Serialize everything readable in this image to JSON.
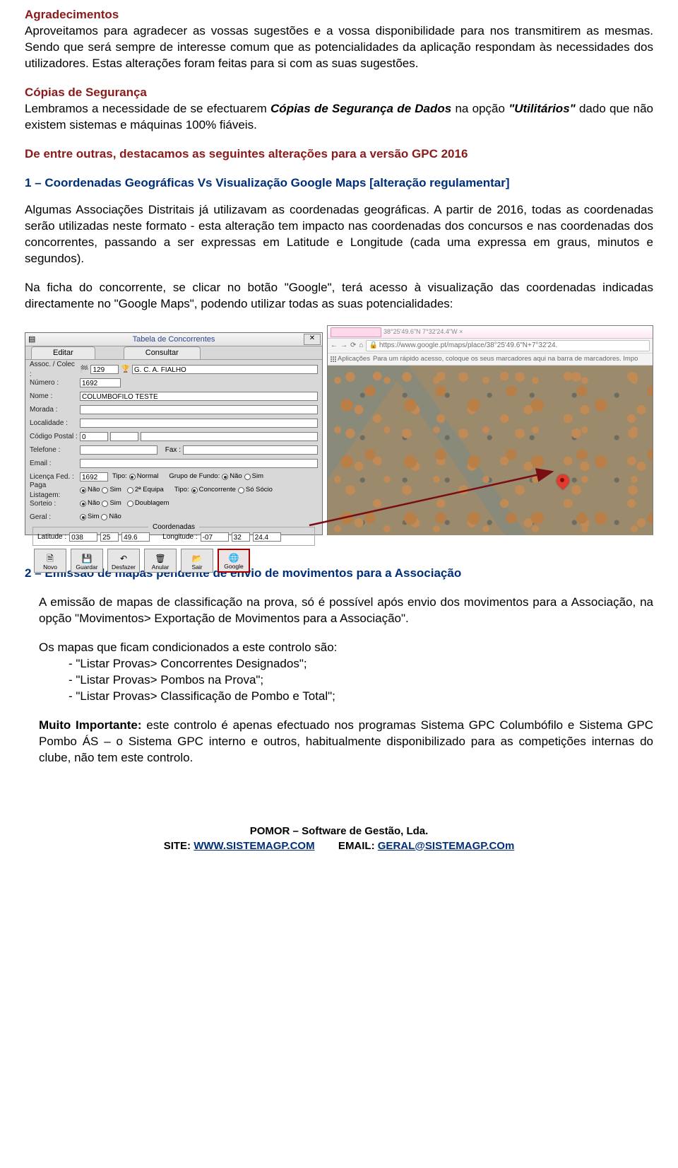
{
  "sec1": {
    "title": "Agradecimentos",
    "p1": "Aproveitamos para agradecer as vossas sugestões e a vossa disponibilidade para nos transmitirem as mesmas. Sendo que será sempre de interesse comum que as potencialidades da aplicação respondam às necessidades dos utilizadores. Estas alterações foram feitas para si com as suas sugestões."
  },
  "sec2": {
    "title": "Cópias de Segurança",
    "p1a": "Lembramos a necessidade de se efectuarem ",
    "p1b": "Cópias de Segurança de Dados",
    "p1c": " na opção ",
    "p1d": "\"Utilitários\"",
    "p1e": " dado que não existem sistemas e máquinas 100% fiáveis."
  },
  "sec3": {
    "title": "De entre outras, destacamos as seguintes alterações para a versão GPC 2016"
  },
  "sec4": {
    "title": "1 – Coordenadas Geográficas Vs Visualização Google Maps [alteração regulamentar]",
    "p1": "Algumas Associações Distritais já utilizavam as coordenadas geográficas. A partir de 2016, todas as coordenadas serão utilizadas neste formato - esta alteração tem impacto nas coordenadas dos concursos e nas coordenadas dos concorrentes, passando a ser expressas em Latitude e Longitude (cada uma expressa em graus, minutos e segundos).",
    "p2": "Na ficha do concorrente, se clicar no botão \"Google\", terá acesso à visualização das coordenadas indicadas directamente no \"Google Maps\", podendo utilizar todas as suas potencialidades:"
  },
  "form": {
    "title": "Tabela de Concorrentes",
    "tab_edit": "Editar",
    "tab_query": "Consultar",
    "assoc_label": "Assoc. / Colec :",
    "assoc_val": "129",
    "assoc_name": "G. C. A. FIALHO",
    "num_label": "Número :",
    "num_val": "1692",
    "nome_label": "Nome :",
    "nome_val": "COLUMBOFILO TESTE",
    "morada_label": "Morada :",
    "local_label": "Localidade :",
    "cp_label": "Código Postal :",
    "cp_val": "0",
    "tel_label": "Telefone :",
    "fax_label": "Fax :",
    "email_label": "Email :",
    "lic_label": "Licença Fed. :",
    "lic_val": "1692",
    "tipo_label": "Tipo:",
    "tipo_normal": "Normal",
    "tipo_2equipa": "2ª Equipa",
    "tipo_doub": "Doublagem",
    "grupo_label": "Grupo de Fundo:",
    "nao": "Não",
    "sim": "Sim",
    "tipo2_label": "Tipo:",
    "concorrente": "Concorrente",
    "sosocio": "Só Sócio",
    "paga_label": "Paga Listagem:",
    "sorteio_label": "Sorteio :",
    "geral_label": "Geral :",
    "coord_title": "Coordenadas",
    "lat_label": "Latitude :",
    "lat_d": "038",
    "lat_m": "25",
    "lat_s": "49.6",
    "lon_label": "Longitude :",
    "lon_d": "-07",
    "lon_m": "32",
    "lon_s": "24.4",
    "btn_novo": "Novo",
    "btn_guardar": "Guardar",
    "btn_desfazer": "Desfazer",
    "btn_anular": "Anular",
    "btn_sair": "Sair",
    "btn_google": "Google"
  },
  "browser": {
    "coords_text": "38°25'49.6\"N 7°32'24.4\"W ×",
    "addr_text": "https://www.google.pt/maps/place/38°25'49.6\"N+7°32'24.",
    "apps_label": "Aplicações",
    "bookmark_hint": "Para um rápido acesso, coloque os seus marcadores aqui na barra de marcadores. Impo"
  },
  "sec5": {
    "title": "2 – Emissão de mapas pendente de envio de movimentos para a Associação",
    "p1": "A emissão de mapas de classificação na prova, só é possível após envio dos movimentos para a Associação, na opção \"Movimentos> Exportação de Movimentos para a Associação\".",
    "p2": "Os mapas que ficam condicionados a este controlo são:",
    "li1": "- \"Listar Provas> Concorrentes Designados\";",
    "li2": "- \"Listar Provas> Pombos na Prova\";",
    "li3": "- \"Listar Provas> Classificação de Pombo e Total\";",
    "p3a": "Muito Importante:",
    "p3b": " este controlo é apenas efectuado nos programas Sistema GPC Columbófilo e Sistema GPC Pombo ÁS – o Sistema GPC interno e outros, habitualmente disponibilizado para as competições internas do clube, não tem este controlo."
  },
  "footer": {
    "l1": "POMOR – Software de Gestão, Lda.",
    "l2a": "SITE: ",
    "l2b": "WWW.SISTEMAGP.COM",
    "l2c": "        EMAIL: ",
    "l2d": "GERAL@SISTEMAGP.COm"
  }
}
